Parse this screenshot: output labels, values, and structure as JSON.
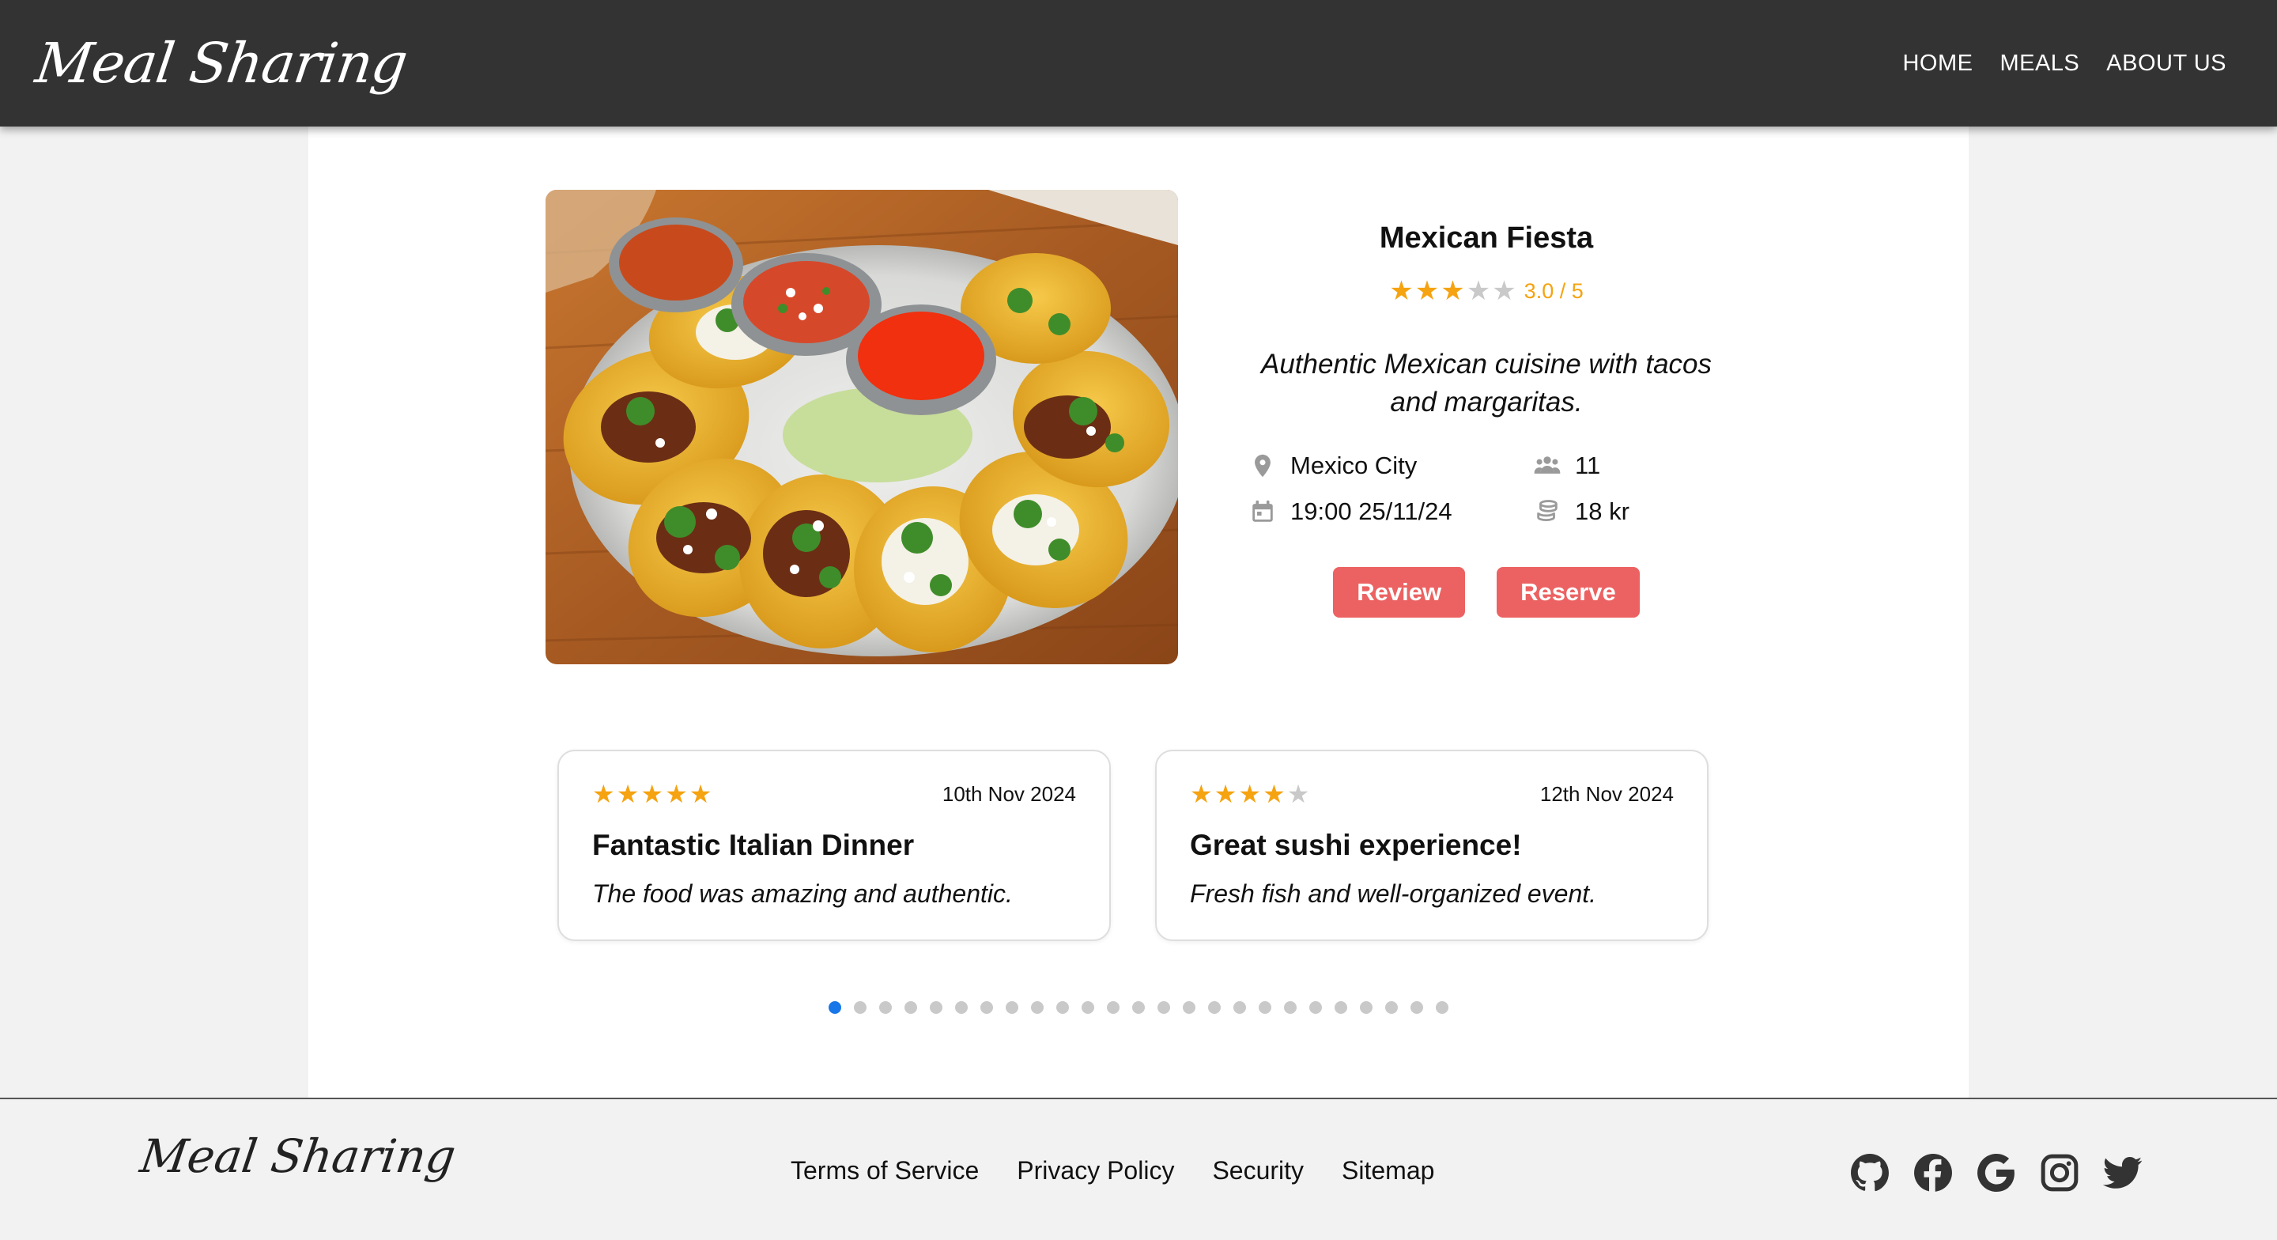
{
  "header": {
    "logo": "Meal Sharing",
    "nav": [
      "HOME",
      "MEALS",
      "ABOUT US"
    ]
  },
  "meal": {
    "title": "Mexican Fiesta",
    "rating": 3,
    "rating_max": 5,
    "rating_text": "3.0 / 5",
    "description": "Authentic Mexican cuisine with tacos and margaritas.",
    "location": "Mexico City",
    "guests": "11",
    "when": "19:00 25/11/24",
    "price": "18 kr",
    "review_button": "Review",
    "reserve_button": "Reserve"
  },
  "reviews": [
    {
      "stars": 5,
      "date": "10th Nov 2024",
      "title": "Fantastic Italian Dinner",
      "text": "The food was amazing and authentic."
    },
    {
      "stars": 4,
      "date": "12th Nov 2024",
      "title": "Great sushi experience!",
      "text": "Fresh fish and well-organized event."
    }
  ],
  "carousel": {
    "total": 25,
    "active": 1
  },
  "footer": {
    "logo": "Meal Sharing",
    "links": [
      "Terms of Service",
      "Privacy Policy",
      "Security",
      "Sitemap"
    ],
    "socials": [
      "github-icon",
      "facebook-icon",
      "google-icon",
      "instagram-icon",
      "twitter-icon"
    ]
  },
  "colors": {
    "header_bg": "#333333",
    "accent": "#ec6262",
    "star": "#f5a311",
    "dot_active": "#1877e8"
  }
}
